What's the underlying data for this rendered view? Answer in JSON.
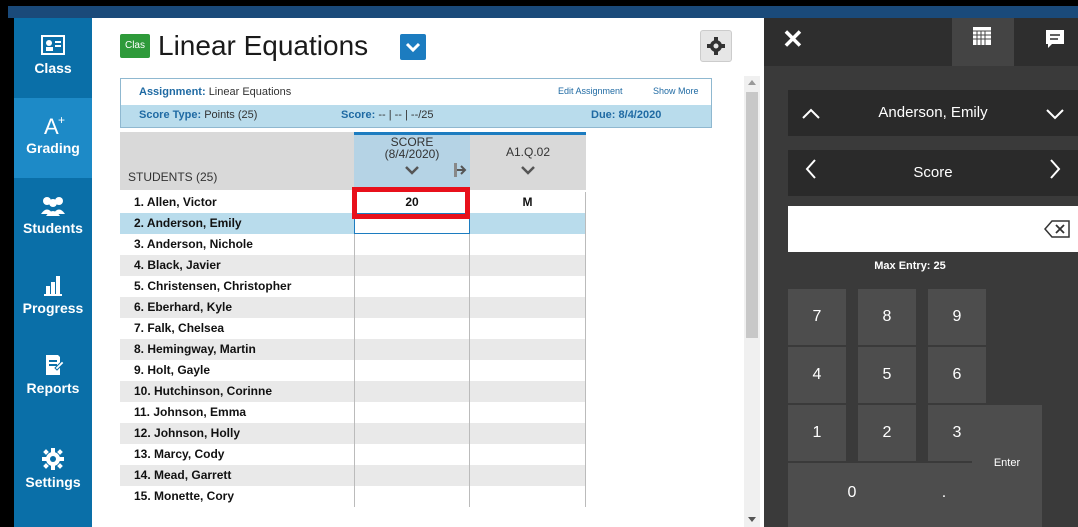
{
  "nav": [
    {
      "label": "Class",
      "icon": "class-icon"
    },
    {
      "label": "Grading",
      "icon": "grading-icon"
    },
    {
      "label": "Students",
      "icon": "students-icon"
    },
    {
      "label": "Progress",
      "icon": "progress-icon"
    },
    {
      "label": "Reports",
      "icon": "reports-icon"
    },
    {
      "label": "Settings",
      "icon": "gear-icon"
    }
  ],
  "header": {
    "class_badge": "Clas",
    "title": "Linear Equations"
  },
  "info": {
    "assignment_label": "Assignment:",
    "assignment_value": "Linear Equations",
    "edit_link": "Edit Assignment",
    "show_more": "Show More",
    "score_type_label": "Score Type:",
    "score_type_value": "Points (25)",
    "score_label": "Score:",
    "score_value": "-- | -- | --/25",
    "due_label": "Due:",
    "due_value": "8/4/2020"
  },
  "grid": {
    "students_header": "STUDENTS (25)",
    "col1_line1": "SCORE",
    "col1_line2": "(8/4/2020)",
    "col2_line1": "A1.Q.02",
    "rows": [
      {
        "name": "1. Allen, Victor",
        "score": "20",
        "a1": "M"
      },
      {
        "name": "2. Anderson, Emily",
        "score": "",
        "a1": ""
      },
      {
        "name": "3. Anderson, Nichole",
        "score": "",
        "a1": ""
      },
      {
        "name": "4. Black, Javier",
        "score": "",
        "a1": ""
      },
      {
        "name": "5. Christensen, Christopher",
        "score": "",
        "a1": ""
      },
      {
        "name": "6. Eberhard, Kyle",
        "score": "",
        "a1": ""
      },
      {
        "name": "7. Falk, Chelsea",
        "score": "",
        "a1": ""
      },
      {
        "name": "8. Hemingway, Martin",
        "score": "",
        "a1": ""
      },
      {
        "name": "9. Holt, Gayle",
        "score": "",
        "a1": ""
      },
      {
        "name": "10. Hutchinson, Corinne",
        "score": "",
        "a1": ""
      },
      {
        "name": "11. Johnson, Emma",
        "score": "",
        "a1": ""
      },
      {
        "name": "12. Johnson, Holly",
        "score": "",
        "a1": ""
      },
      {
        "name": "13. Marcy, Cody",
        "score": "",
        "a1": ""
      },
      {
        "name": "14. Mead, Garrett",
        "score": "",
        "a1": ""
      },
      {
        "name": "15. Monette, Cory",
        "score": "",
        "a1": ""
      }
    ]
  },
  "pad": {
    "close": "✕",
    "student": "Anderson, Emily",
    "field": "Score",
    "max_entry": "Max Entry: 25",
    "enter": "Enter",
    "keys": [
      "7",
      "8",
      "9",
      "4",
      "5",
      "6",
      "1",
      "2",
      "3"
    ],
    "zero": "0",
    "dot": "."
  },
  "colors": {
    "nav_bg": "#0a6fa8",
    "accent": "#1c7cc0",
    "highlight": "#e8101b"
  }
}
